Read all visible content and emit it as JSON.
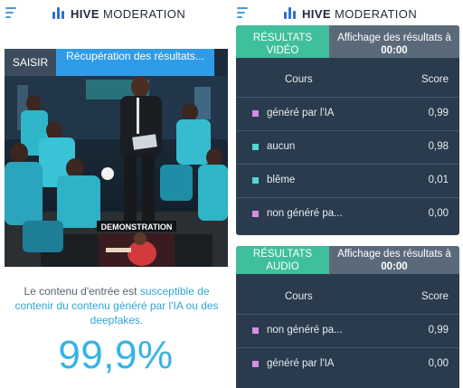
{
  "header": {
    "brand_bold": "HIVE",
    "brand_rest": " MODERATION"
  },
  "left": {
    "saisir_label": "SAISIR",
    "status_text": "Récupération des résultats...",
    "banner_text": "DEMONSTRATION",
    "description_prefix": "Le contenu d'entrée est ",
    "description_highlight": "susceptible de contenir du contenu généré par l'IA ou des deepfakes.",
    "score": "99,9%"
  },
  "video_results": {
    "tab_label": "RÉSULTATS VIDÉO",
    "tab2_line1": "Affichage des résultats à",
    "tab2_time": "00:00",
    "col_course": "Cours",
    "col_score": "Score",
    "rows": [
      {
        "label": "généré par l'IA",
        "value": "0,99",
        "color": "#d68ee6"
      },
      {
        "label": "aucun",
        "value": "0,98",
        "color": "#4fd7d3"
      },
      {
        "label": "blême",
        "value": "0,01",
        "color": "#4fd7d3"
      },
      {
        "label": " non généré pa...",
        "value": "0,00",
        "color": "#d68ee6"
      }
    ]
  },
  "audio_results": {
    "tab_label": "RÉSULTATS AUDIO",
    "tab2_line1": "Affichage des résultats à",
    "tab2_time": "00:00",
    "col_course": "Cours",
    "col_score": "Score",
    "rows": [
      {
        "label": " non généré pa...",
        "value": "0,99",
        "color": "#d68ee6"
      },
      {
        "label": "généré par l'IA",
        "value": "0,00",
        "color": "#d68ee6"
      }
    ]
  },
  "colors": {
    "accent_blue": "#2f9cea",
    "score_blue": "#36b3e6",
    "tab_green": "#3fbf9b",
    "card_bg": "#2a3b4d"
  }
}
